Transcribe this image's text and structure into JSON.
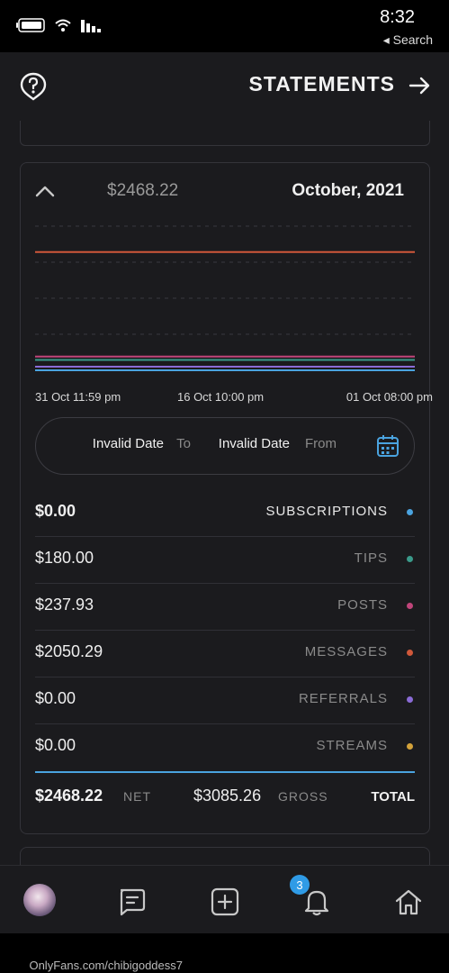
{
  "status_bar": {
    "time": "8:32",
    "back_label": "◂ Search"
  },
  "header": {
    "title": "STATEMENTS"
  },
  "statement": {
    "month": "October, 2021",
    "amount": "$2468.22",
    "date_range": {
      "from_label": "From",
      "from_value": "Invalid Date",
      "to_label": "To",
      "to_value": "Invalid Date"
    },
    "rows": [
      {
        "label": "SUBSCRIPTIONS",
        "value": "$0.00",
        "color": "#4aa3df"
      },
      {
        "label": "TIPS",
        "value": "$180.00",
        "color": "#3a9a8a"
      },
      {
        "label": "POSTS",
        "value": "$237.93",
        "color": "#c0457a"
      },
      {
        "label": "MESSAGES",
        "value": "$2050.29",
        "color": "#d0583a"
      },
      {
        "label": "REFERRALS",
        "value": "$0.00",
        "color": "#8a6bd6"
      },
      {
        "label": "STREAMS",
        "value": "$0.00",
        "color": "#d4a23a"
      }
    ],
    "total": {
      "label": "TOTAL",
      "gross_label": "GROSS",
      "gross_value": "$3085.26",
      "net_label": "NET",
      "net_value": "$2468.22"
    }
  },
  "chart_data": {
    "type": "line",
    "x_ticks": [
      "01 Oct 08:00 pm",
      "16 Oct 10:00 pm",
      "31 Oct 11:59 pm"
    ],
    "series": [
      {
        "name": "MESSAGES",
        "color": "#d0583a",
        "values": [
          2050.29,
          2050.29
        ]
      },
      {
        "name": "POSTS",
        "color": "#c0457a",
        "values": [
          237.93,
          237.93
        ]
      },
      {
        "name": "TIPS",
        "color": "#3a9a8a",
        "values": [
          180.0,
          180.0
        ]
      },
      {
        "name": "REFERRALS",
        "color": "#8a6bd6",
        "values": [
          0.0,
          0.0
        ]
      },
      {
        "name": "SUBSCRIPTIONS",
        "color": "#4aa3df",
        "values": [
          0.0,
          0.0
        ]
      }
    ],
    "ylim": [
      0,
      2500
    ],
    "grid": true
  },
  "bottom_nav": {
    "notification_count": "3"
  },
  "footer": {
    "url": "OnlyFans.com/chibigoddess7"
  }
}
